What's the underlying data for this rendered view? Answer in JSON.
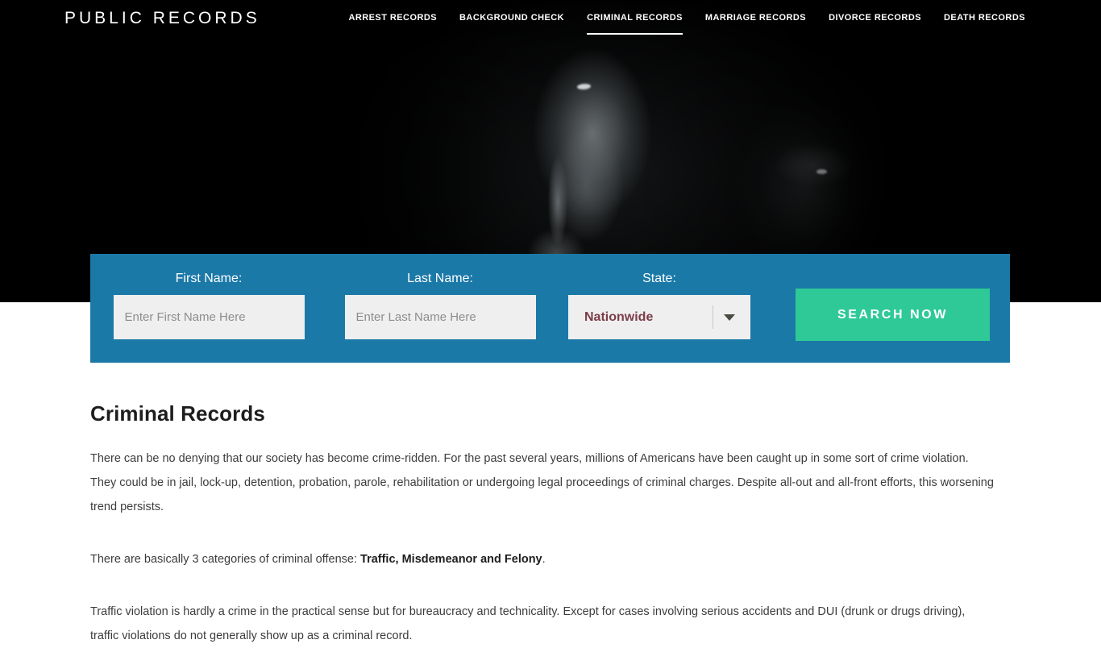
{
  "header": {
    "brand": "PUBLIC RECORDS",
    "nav": [
      {
        "label": "ARREST RECORDS",
        "active": false
      },
      {
        "label": "BACKGROUND CHECK",
        "active": false
      },
      {
        "label": "CRIMINAL RECORDS",
        "active": true
      },
      {
        "label": "MARRIAGE RECORDS",
        "active": false
      },
      {
        "label": "DIVORCE RECORDS",
        "active": false
      },
      {
        "label": "DEATH RECORDS",
        "active": false
      }
    ]
  },
  "hero": {
    "description": "Dark black-and-white photograph of a man holding an index finger to his lips in a shh gesture"
  },
  "search": {
    "first_name_label": "First Name:",
    "first_name_placeholder": "Enter First Name Here",
    "first_name_value": "",
    "last_name_label": "Last Name:",
    "last_name_placeholder": "Enter Last Name Here",
    "last_name_value": "",
    "state_label": "State:",
    "state_value": "Nationwide",
    "state_arrow_icon": "chevron-down-icon",
    "submit_label": "SEARCH NOW"
  },
  "article": {
    "title": "Criminal Records",
    "paragraph_1": "There can be no denying that our society has become crime-ridden. For the past several years, millions of Americans have been caught up in some sort of crime violation. They could be in jail, lock-up, detention, probation, parole, rehabilitation or undergoing legal proceedings of criminal charges. Despite all-out and all-front efforts, this worsening trend persists.",
    "paragraph_2_lead": "There are basically 3 categories of criminal offense: ",
    "paragraph_2_bold": "Traffic, Misdemeanor and Felony",
    "paragraph_2_tail": ".",
    "paragraph_3": "Traffic violation is hardly a crime in the practical sense but for bureaucracy and technicality. Except for cases involving serious accidents and DUI (drunk or drugs driving), traffic violations do not generally show up as a criminal record."
  },
  "colors": {
    "panel_blue": "#1b79a8",
    "button_green": "#2ec996",
    "select_text": "#7c3d48",
    "header_black": "#000000"
  }
}
